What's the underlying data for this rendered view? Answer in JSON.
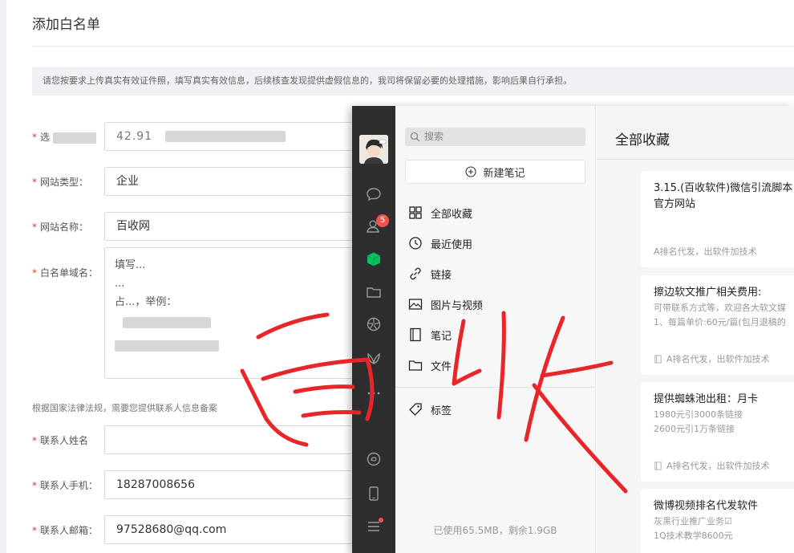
{
  "page": {
    "title": "添加白名单",
    "notice": "请您按要求上传真实有效证件照，填写真实有效信息，后续核查发现提供虚假信息的，我司将保留必要的处理措施，影响后果自行承担。"
  },
  "form": {
    "fields": [
      {
        "label": "选",
        "value": "42.91"
      },
      {
        "label": "网站类型：",
        "value": "企业"
      },
      {
        "label": "网站名称：",
        "value": "百收网"
      },
      {
        "label": "白名单域名：",
        "value": "填写...\n...\n占...，举例："
      },
      {
        "label": "联系人姓名",
        "value": ""
      },
      {
        "label": "联系人手机：",
        "value": "18287008656"
      },
      {
        "label": "联系人邮箱：",
        "value": "97528680@qq.com"
      }
    ],
    "required_mark": "*",
    "section_note": "根据国家法律法规，需要您提供联系人信息备案"
  },
  "favorites_app": {
    "nav_badge": "5",
    "search_placeholder": "搜索",
    "new_note_label": "新建笔记",
    "categories": [
      {
        "label": "全部收藏",
        "icon": "grid-icon"
      },
      {
        "label": "最近使用",
        "icon": "clock-icon"
      },
      {
        "label": "链接",
        "icon": "link-icon"
      },
      {
        "label": "图片与视频",
        "icon": "image-icon"
      },
      {
        "label": "笔记",
        "icon": "notebook-icon"
      },
      {
        "label": "文件",
        "icon": "folder-icon"
      },
      {
        "label": "标签",
        "icon": "tag-icon"
      }
    ],
    "storage_text": "已使用65.5MB，剩余1.9GB",
    "main_title": "全部收藏",
    "cards": [
      {
        "title": "3.15.(百收软件)微信引流脚本",
        "lines": [
          "官方网站"
        ],
        "source": "A排名代发，出软件加技术"
      },
      {
        "title": "擦边软文推广相关费用:",
        "lines": [
          "可带联系方式等，欢迎各大软文媒",
          "1、每篇单价:60元/篇(包月退稿的"
        ],
        "source": "A排名代发，出软件加技术"
      },
      {
        "title": "提供蜘蛛池出租：月卡",
        "lines": [
          "1980元引3000条链接",
          "2600元引1万条链接"
        ],
        "source": "A排名代发，出软件加技术"
      },
      {
        "title": "微博视频排名代发软件",
        "lines": [
          "灰黑行业推广业务☑",
          "1Q技术教学8600元"
        ],
        "source": ""
      }
    ]
  },
  "overlay": {
    "handwriting": "百收",
    "color": "#e8262a"
  },
  "colors": {
    "accent_green": "#07c160",
    "badge_red": "#fa5151",
    "rail_dark": "#2e2e2e"
  }
}
